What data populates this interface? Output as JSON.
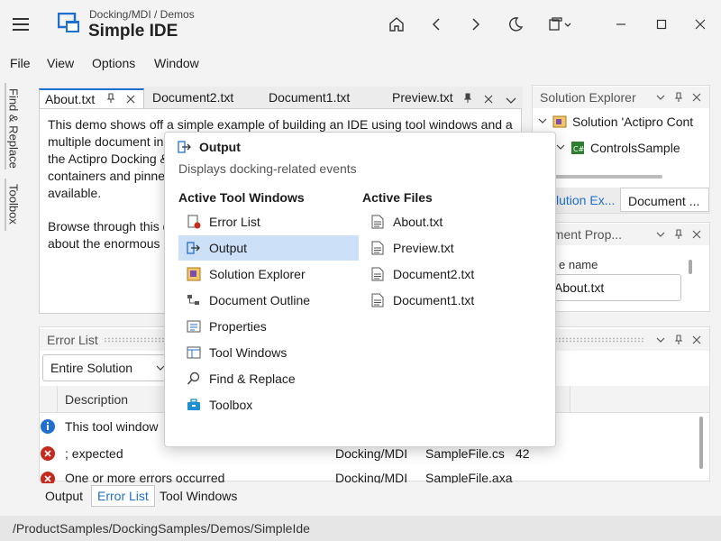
{
  "titlebar": {
    "breadcrumb": "Docking/MDI / Demos",
    "title": "Simple IDE"
  },
  "menu": [
    "File",
    "View",
    "Options",
    "Window"
  ],
  "side_tabs": [
    "Find & Replace",
    "Toolbox"
  ],
  "document_tabs": [
    {
      "label": "About.txt",
      "active": true
    },
    {
      "label": "Document2.txt",
      "active": false
    },
    {
      "label": "Document1.txt",
      "active": false
    },
    {
      "label": "Preview.txt",
      "active": false
    }
  ],
  "document_text": {
    "line1": "This demo shows off a simple example of building an IDE using tool windows and a",
    "line2": "multiple document in",
    "line3": "the Actipro Docking &",
    "line4": "containers and pinne",
    "line5": "available.",
    "line6": "Browse through this d",
    "line7": "about the enormous"
  },
  "solution_explorer": {
    "title": "Solution Explorer",
    "root": "Solution 'Actipro Cont",
    "child": "ControlsSample",
    "tabs": [
      "lution Ex...",
      "Document ..."
    ]
  },
  "doc_properties": {
    "title": "cument Prop...",
    "field_label": "e name",
    "field_value": "About.txt"
  },
  "error_list": {
    "title": "Error List",
    "filter": "Entire Solution",
    "column": "Description",
    "rows": [
      {
        "icon": "info-icon",
        "text": "This tool window",
        "project": "",
        "file": "",
        "line": ""
      },
      {
        "icon": "error-icon",
        "text": "; expected",
        "project": "Docking/MDI",
        "file": "SampleFile.cs",
        "line": "42"
      },
      {
        "icon": "error-icon",
        "text": "One or more errors occurred",
        "project": "Docking/MDI",
        "file": "SampleFile.axa",
        "line": ""
      }
    ]
  },
  "bottom_tabs": [
    {
      "label": "Output",
      "active": false
    },
    {
      "label": "Error List",
      "active": true
    },
    {
      "label": "Tool Windows",
      "active": false
    }
  ],
  "popup": {
    "title": "Output",
    "subtitle": "Displays docking-related events",
    "tool_windows_header": "Active Tool Windows",
    "files_header": "Active Files",
    "tool_windows": [
      {
        "label": "Error List",
        "icon": "error-list-icon"
      },
      {
        "label": "Output",
        "icon": "output-icon",
        "selected": true
      },
      {
        "label": "Solution Explorer",
        "icon": "solution-explorer-icon"
      },
      {
        "label": "Document Outline",
        "icon": "document-outline-icon"
      },
      {
        "label": "Properties",
        "icon": "properties-icon"
      },
      {
        "label": "Tool Windows",
        "icon": "tool-windows-icon"
      },
      {
        "label": "Find & Replace",
        "icon": "find-icon"
      },
      {
        "label": "Toolbox",
        "icon": "toolbox-icon"
      }
    ],
    "files": [
      "About.txt",
      "Preview.txt",
      "Document2.txt",
      "Document1.txt"
    ]
  },
  "status": "/ProductSamples/DockingSamples/Demos/SimpleIde",
  "colors": {
    "accent": "#1f6fd1",
    "selection": "#cce0f8",
    "error": "#c42b1c",
    "info": "#1f6fd1"
  }
}
